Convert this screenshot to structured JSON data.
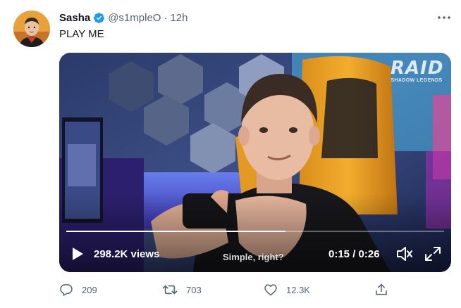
{
  "tweet": {
    "author": {
      "display_name": "Sasha",
      "handle": "@s1mpleO",
      "verified_icon": "verified-badge-icon"
    },
    "separator": "·",
    "time": "12h",
    "text": "PLAY ME",
    "more_icon": "more-icon"
  },
  "media": {
    "type": "video",
    "brand": {
      "title": "RAID",
      "subtitle": "SHADOW LEGENDS"
    },
    "caption": "Simple, right?",
    "views": "298.2K views",
    "time_display": "0:15 / 0:26",
    "progress": 0.58,
    "controls": {
      "play_icon": "play-icon",
      "volume_icon": "volume-icon",
      "fullscreen_icon": "fullscreen-icon"
    }
  },
  "actions": {
    "reply": {
      "icon": "reply-icon",
      "count": "209"
    },
    "retweet": {
      "icon": "retweet-icon",
      "count": "703"
    },
    "like": {
      "icon": "like-icon",
      "count": "12.3K"
    },
    "share": {
      "icon": "share-icon"
    }
  },
  "colors": {
    "verified": "#1d9bf0",
    "secondary_text": "#536471",
    "primary_text": "#0f1419"
  }
}
